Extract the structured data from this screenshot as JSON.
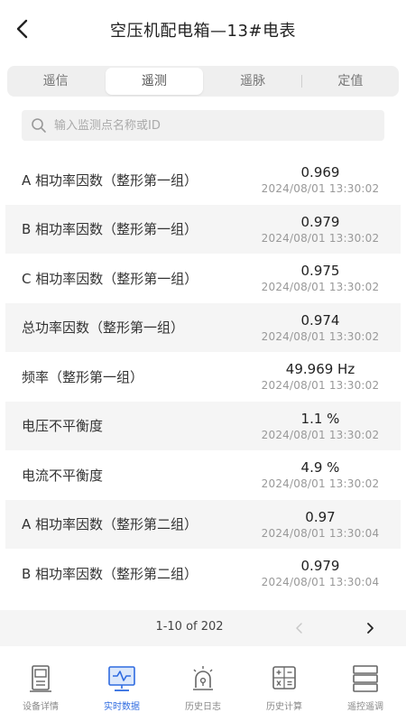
{
  "header": {
    "title": "空压机配电箱—13#电表"
  },
  "tabs": [
    {
      "label": "遥信",
      "active": false
    },
    {
      "label": "遥测",
      "active": true
    },
    {
      "label": "遥脉",
      "active": false
    },
    {
      "label": "定值",
      "active": false
    }
  ],
  "search": {
    "placeholder": "输入监测点名称或ID",
    "value": ""
  },
  "rows": [
    {
      "label": "A 相功率因数（整形第一组）",
      "value": "0.969",
      "time": "2024/08/01 13:30:02"
    },
    {
      "label": "B 相功率因数（整形第一组）",
      "value": "0.979",
      "time": "2024/08/01 13:30:02"
    },
    {
      "label": "C 相功率因数（整形第一组）",
      "value": "0.975",
      "time": "2024/08/01 13:30:02"
    },
    {
      "label": "总功率因数（整形第一组）",
      "value": "0.974",
      "time": "2024/08/01 13:30:02"
    },
    {
      "label": "频率（整形第一组）",
      "value": "49.969 Hz",
      "time": "2024/08/01 13:30:02"
    },
    {
      "label": "电压不平衡度",
      "value": "1.1 %",
      "time": "2024/08/01 13:30:02"
    },
    {
      "label": "电流不平衡度",
      "value": "4.9 %",
      "time": "2024/08/01 13:30:02"
    },
    {
      "label": "A 相功率因数（整形第二组）",
      "value": "0.97",
      "time": "2024/08/01 13:30:04"
    },
    {
      "label": "B 相功率因数（整形第二组）",
      "value": "0.979",
      "time": "2024/08/01 13:30:04"
    }
  ],
  "pager": {
    "text": "1-10 of 202"
  },
  "bottom_nav": [
    {
      "label": "设备详情",
      "icon": "device-detail-icon",
      "active": false
    },
    {
      "label": "实时数据",
      "icon": "realtime-monitor-icon",
      "active": true
    },
    {
      "label": "历史日志",
      "icon": "alarm-light-icon",
      "active": false
    },
    {
      "label": "历史计算",
      "icon": "calculator-icon",
      "active": false
    },
    {
      "label": "遥控遥调",
      "icon": "remote-control-icon",
      "active": false
    }
  ],
  "colors": {
    "accent": "#2f6be0",
    "inactive": "#888888",
    "alt_row": "#f5f5f5"
  }
}
